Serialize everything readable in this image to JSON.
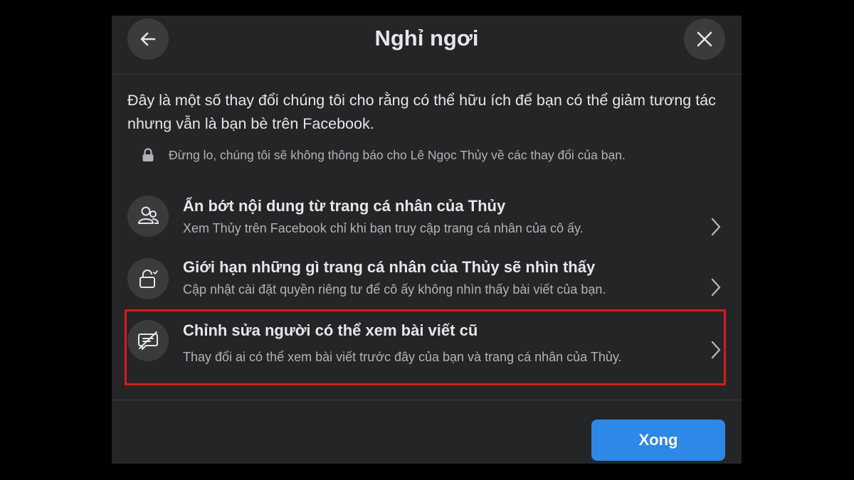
{
  "dialog": {
    "title": "Nghỉ ngơi",
    "intro": "Đây là một số thay đổi chúng tôi cho rằng có thể hữu ích để bạn có thể giảm tương tác nhưng vẫn là bạn bè trên Facebook.",
    "notice": "Đừng lo, chúng tôi sẽ không thông báo cho Lê Ngọc Thủy về các thay đổi của bạn.",
    "options": [
      {
        "title": "Ẩn bớt nội dung từ trang cá nhân của Thủy",
        "description": "Xem Thủy trên Facebook chỉ khi bạn truy cập trang cá nhân của cô ấy.",
        "icon": "people-icon"
      },
      {
        "title": "Giới hạn những gì trang cá nhân của Thủy sẽ nhìn thấy",
        "description": "Cập nhật cài đặt quyền riêng tư để cô ấy không nhìn thấy bài viết của bạn.",
        "icon": "lock-icon"
      },
      {
        "title": "Chỉnh sửa người có thể xem bài viết cũ",
        "description": "Thay đổi ai có thể xem bài viết trước đây của bạn và trang cá nhân của Thủy.",
        "icon": "post-hidden-icon"
      }
    ],
    "done_label": "Xong"
  },
  "colors": {
    "background": "#000000",
    "dialog_bg": "#242526",
    "button_bg": "#3a3b3c",
    "primary": "#2d88e7",
    "highlight": "#e0161b",
    "text_primary": "#e4e6eb",
    "text_secondary": "#b0b3b8"
  }
}
